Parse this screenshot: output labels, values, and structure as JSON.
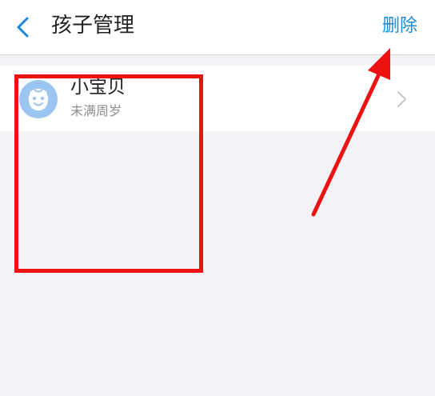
{
  "nav": {
    "back_icon": "chevron-left-icon",
    "title": "孩子管理",
    "delete_label": "删除"
  },
  "children": [
    {
      "name": "小宝贝",
      "age": "未满周岁",
      "avatar_icon": "baby-face-icon",
      "chevron_icon": "chevron-right-icon"
    }
  ],
  "colors": {
    "accent": "#1a88d8",
    "annotation": "#ee1111",
    "avatar_bg": "#9cc6f2"
  }
}
